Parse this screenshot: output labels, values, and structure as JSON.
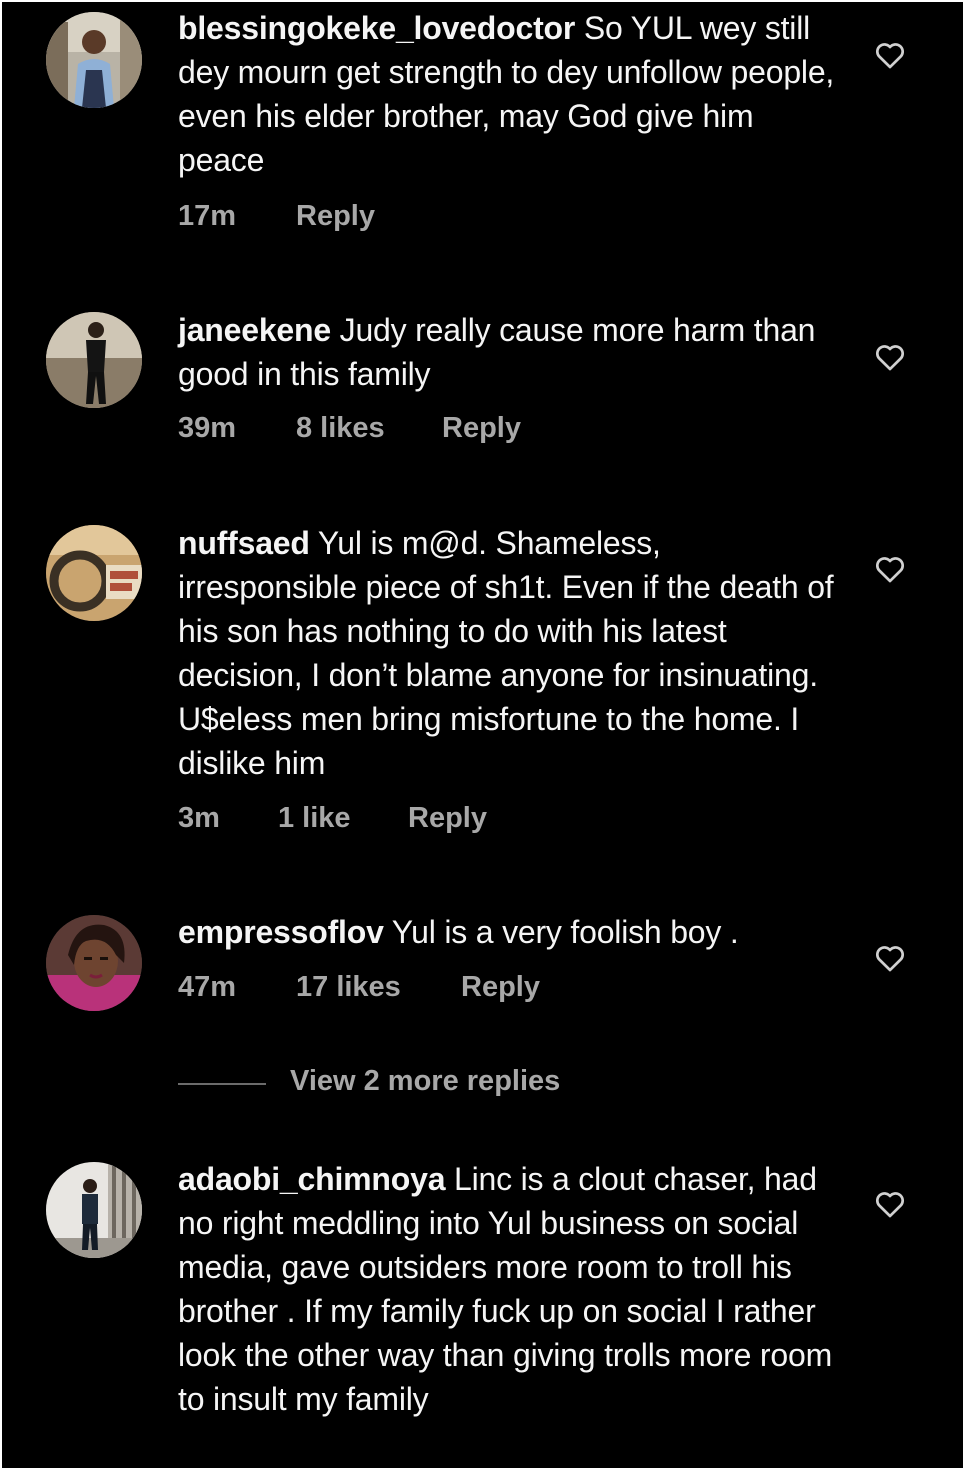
{
  "comments": [
    {
      "username": "blessingokeke_lovedoctor",
      "text": " So YUL wey still dey mourn get strength to dey unfollow people, even his elder brother, may God give him peace",
      "time": "17m",
      "likes": "",
      "reply_label": "Reply",
      "avatar_icon": "user-avatar",
      "like_icon": "heart-outline-icon"
    },
    {
      "username": "janeekene",
      "text": " Judy really cause more harm than good in this family",
      "time": "39m",
      "likes": "8 likes",
      "reply_label": "Reply",
      "avatar_icon": "user-avatar",
      "like_icon": "heart-outline-icon"
    },
    {
      "username": "nuffsaed",
      "text": " Yul is m@d. Shameless, irresponsible piece of sh1t. Even if the death of his son has nothing to do with his latest decision, I don’t blame anyone for insinuating. U$eless men bring misfortune to the home. I dislike him",
      "time": "3m",
      "likes": "1 like",
      "reply_label": "Reply",
      "avatar_icon": "user-avatar",
      "like_icon": "heart-outline-icon"
    },
    {
      "username": "empressoflov",
      "text": " Yul is a very foolish boy .",
      "time": "47m",
      "likes": "17 likes",
      "reply_label": "Reply",
      "avatar_icon": "user-avatar",
      "like_icon": "heart-outline-icon"
    },
    {
      "username": "adaobi_chimnoya",
      "text": " Linc is a clout chaser, had no right meddling into Yul business on social media, gave outsiders more room to troll his brother . If my family fuck up on social I rather look the other way than giving trolls more room to insult my family",
      "time": "",
      "likes": "",
      "reply_label": "",
      "avatar_icon": "user-avatar",
      "like_icon": "heart-outline-icon"
    }
  ],
  "view_replies": "View 2 more replies",
  "colors": {
    "background": "#000000",
    "text": "#f5f5f5",
    "secondary": "#a8a8a8",
    "divider": "#6b6b6b"
  }
}
